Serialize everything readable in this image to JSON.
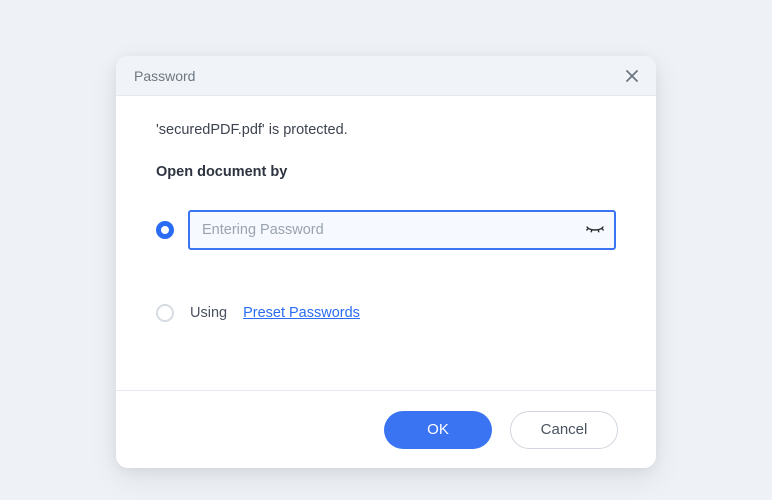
{
  "dialog": {
    "title": "Password",
    "status_line": "'securedPDF.pdf' is protected.",
    "section_label": "Open document by",
    "selected_option": "entering",
    "password_input": {
      "placeholder": "Entering Password",
      "value": ""
    },
    "preset_option": {
      "using_label": "Using",
      "link_label": "Preset Passwords"
    },
    "buttons": {
      "ok": "OK",
      "cancel": "Cancel"
    }
  }
}
